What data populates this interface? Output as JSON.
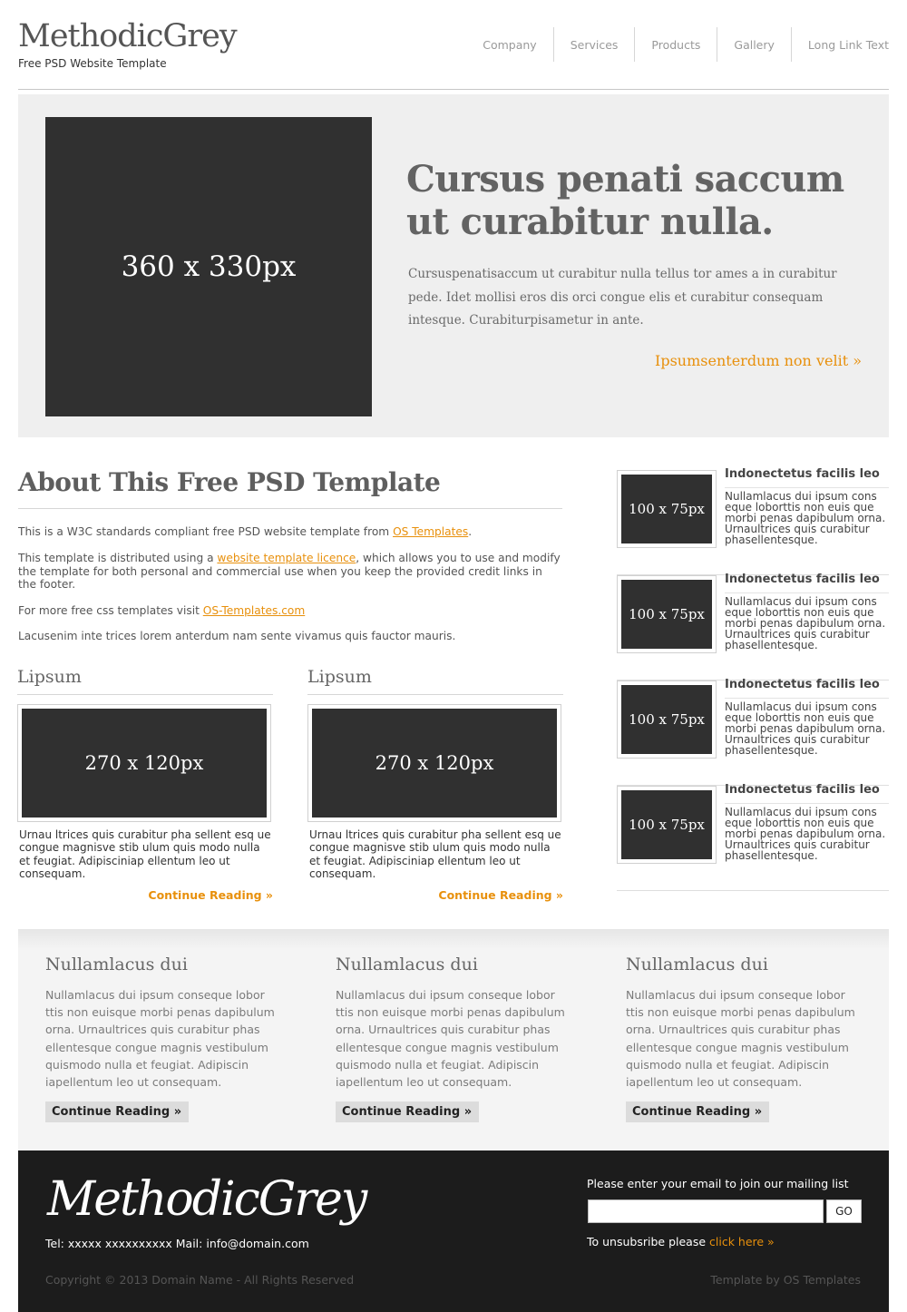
{
  "header": {
    "logo": "MethodicGrey",
    "tagline": "Free PSD Website Template",
    "nav": [
      "Company",
      "Services",
      "Products",
      "Gallery",
      "Long Link Text"
    ]
  },
  "hero": {
    "image_label": "360 x 330px",
    "title": "Cursus penati saccum ut curabitur nulla.",
    "text": "Cursuspenatisaccum ut curabitur nulla tellus tor ames a in curabitur pede. Idet mollisi eros dis orci congue elis et curabitur consequam intesque. Curabiturpisametur in ante.",
    "link": "Ipsumsenterdum non velit »"
  },
  "about": {
    "title": "About This Free PSD Template",
    "p1": {
      "before": "This is a W3C standards compliant free PSD website template from ",
      "link": "OS Templates",
      "after": "."
    },
    "p2": {
      "before": "This template is distributed using a ",
      "link": "website template licence",
      "after": ", which allows you to use and modify the template for both personal and commercial use when you keep the provided credit links in the footer."
    },
    "p3": {
      "before": "For more free css templates visit ",
      "link": "OS-Templates.com",
      "after": ""
    },
    "p4": "Lacusenim inte trices lorem anterdum nam sente vivamus quis fauctor mauris."
  },
  "columns": [
    {
      "title": "Lipsum",
      "image_label": "270 x 120px",
      "text": "Urnau ltrices quis curabitur pha sellent esq ue congue magnisve stib ulum quis modo nulla et feugiat. Adipisciniap ellentum leo ut consequam.",
      "link": "Continue Reading »"
    },
    {
      "title": "Lipsum",
      "image_label": "270 x 120px",
      "text": "Urnau ltrices quis curabitur pha sellent esq ue congue magnisve stib ulum quis modo nulla et feugiat. Adipisciniap ellentum leo ut consequam.",
      "link": "Continue Reading »"
    }
  ],
  "sidebar": [
    {
      "image_label": "100 x 75px",
      "title": "Indonectetus facilis leo",
      "text": "Nullamlacus dui ipsum cons eque loborttis non euis que morbi penas dapibulum orna. Urnaultrices quis curabitur phasellentesque."
    },
    {
      "image_label": "100 x 75px",
      "title": "Indonectetus facilis leo",
      "text": "Nullamlacus dui ipsum cons eque loborttis non euis que morbi penas dapibulum orna. Urnaultrices quis curabitur phasellentesque."
    },
    {
      "image_label": "100 x 75px",
      "title": "Indonectetus facilis leo",
      "text": "Nullamlacus dui ipsum cons eque loborttis non euis que morbi penas dapibulum orna. Urnaultrices quis curabitur phasellentesque."
    },
    {
      "image_label": "100 x 75px",
      "title": "Indonectetus facilis leo",
      "text": "Nullamlacus dui ipsum cons eque loborttis non euis que morbi penas dapibulum orna. Urnaultrices quis curabitur phasellentesque."
    }
  ],
  "band": [
    {
      "title": "Nullamlacus dui",
      "text": "Nullamlacus dui ipsum conseque lobor ttis non euisque morbi penas dapibulum orna. Urnaultrices quis curabitur phas ellentesque congue magnis vestibulum quismodo nulla et feugiat. Adipiscin iapellentum leo ut consequam.",
      "button": "Continue Reading »"
    },
    {
      "title": "Nullamlacus dui",
      "text": "Nullamlacus dui ipsum conseque lobor ttis non euisque morbi penas dapibulum orna. Urnaultrices quis curabitur phas ellentesque congue magnis vestibulum quismodo nulla et feugiat. Adipiscin iapellentum leo ut consequam.",
      "button": "Continue Reading »"
    },
    {
      "title": "Nullamlacus dui",
      "text": "Nullamlacus dui ipsum conseque lobor ttis non euisque morbi penas dapibulum orna. Urnaultrices quis curabitur phas ellentesque congue magnis vestibulum quismodo nulla et feugiat. Adipiscin iapellentum leo ut consequam.",
      "button": "Continue Reading »"
    }
  ],
  "footer": {
    "logo": "MethodicGrey",
    "contact": "Tel: xxxxx xxxxxxxxxx Mail: info@domain.com",
    "copyright": "Copyright © 2013 Domain Name - All Rights Reserved",
    "credit": "Template by OS Templates",
    "mailing_label": "Please enter your email to join our mailing list",
    "email_value": "",
    "go_label": "GO",
    "unsubscribe_text": "To unsubsribe please ",
    "unsubscribe_link": "click here »"
  },
  "colors": {
    "accent": "#e8900c",
    "image_placeholder": "#303030",
    "hero_bg": "#efefef",
    "footer_bg": "#1c1c1c"
  }
}
